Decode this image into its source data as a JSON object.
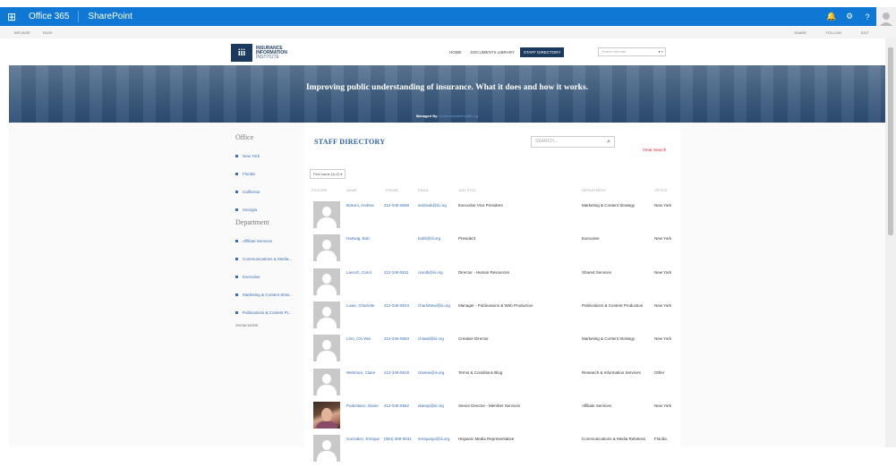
{
  "suite": {
    "waffle": "⊞",
    "app_name": "Office 365",
    "product": "SharePoint",
    "icons": [
      "bell-icon",
      "gear-icon",
      "help-icon"
    ]
  },
  "ribbon": {
    "browse": "BROWSE",
    "page": "PAGE",
    "share": "SHARE",
    "follow": "FOLLOW",
    "edit": "EDIT"
  },
  "header": {
    "logo_line1": "INSURANCE",
    "logo_line2": "INFORMATION",
    "logo_line3": "INSTITUTE",
    "logo_mark": "iii",
    "nav": [
      "HOME",
      "DOCUMENTS LIBRARY",
      "STAFF DIRECTORY"
    ],
    "search_placeholder": "Search this site"
  },
  "banner": {
    "tagline": "Improving public understanding of insurance. What it does and how it works.",
    "managed_label": "Managed By:",
    "managed_value": "Communications@iii.org"
  },
  "sidebar": {
    "office_heading": "Office",
    "offices": [
      "New York",
      "Florida",
      "California",
      "Georgia"
    ],
    "department_heading": "Department",
    "departments": [
      "Affiliate Services",
      "Communications & Media...",
      "Executive",
      "Marketing & Content Strat...",
      "Publications & Content Pr..."
    ],
    "show_more": "SHOW MORE"
  },
  "directory": {
    "title": "STAFF DIRECTORY",
    "search_placeholder": "SEARCH...",
    "clear_search": "Clear Search",
    "filter": "First name (A-Z) ▾",
    "columns": [
      "PICTURE",
      "NAME",
      "PHONE",
      "EMAIL",
      "JOB TITLE",
      "DEPARTMENT",
      "OFFICE"
    ],
    "rows": [
      {
        "name": "Bokoni, Andrea",
        "phone": "212-346-5558",
        "email": "andreab@iii.org",
        "job": "Executive Vice President",
        "dept": "Marketing & Content Strategy",
        "office": "New York",
        "photo": false
      },
      {
        "name": "Hartwig, Bob",
        "phone": "",
        "email": "bobh@iii.org",
        "job": "President",
        "dept": "Executive",
        "office": "New York",
        "photo": false
      },
      {
        "name": "Lavoch, Carol",
        "phone": "212-346-5511",
        "email": "carolb@iii.org",
        "job": "Director - Human Resources",
        "dept": "Shared Services",
        "office": "New York",
        "photo": false
      },
      {
        "name": "Lowe, Charlotte",
        "phone": "212-346-5523",
        "email": "charlottew@iii.org",
        "job": "Manager - Publications & Web Production",
        "dept": "Publications & Content Production",
        "office": "New York",
        "photo": false
      },
      {
        "name": "Lhm, Chi Wai",
        "phone": "212-346-5553",
        "email": "chiwail@iii.org",
        "job": "Creative Director",
        "dept": "Marketing & Content Strategy",
        "office": "New York",
        "photo": false
      },
      {
        "name": "Wetmore, Claire",
        "phone": "212-346-5519",
        "email": "clairew@iii.org",
        "job": "Terms & Conditions Blog",
        "dept": "Research & Information Services",
        "office": "Other",
        "photo": false
      },
      {
        "name": "Podestano, Diane",
        "phone": "212-346-5562",
        "email": "dianep@iii.org",
        "job": "Senior Director - Member Services",
        "dept": "Affiliate Services",
        "office": "New York",
        "photo": true
      },
      {
        "name": "Gonzalez, Enrique",
        "phone": "(954) 389-9531",
        "email": "enriquego@iii.org",
        "job": "Hispanic Media Representative",
        "dept": "Communications & Media Relations",
        "office": "Florida",
        "photo": false
      }
    ]
  }
}
